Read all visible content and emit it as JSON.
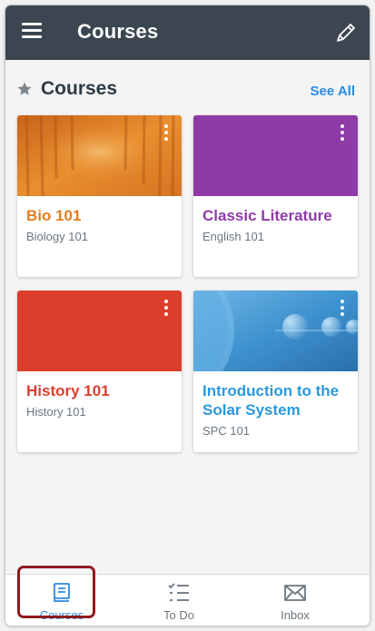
{
  "app_bar": {
    "title": "Courses",
    "menu_icon": "hamburger-menu-icon",
    "edit_icon": "pencil-icon"
  },
  "section": {
    "title": "Courses",
    "see_all": "See All",
    "star_icon": "star-icon"
  },
  "courses": [
    {
      "name": "Bio 101",
      "code": "Biology 101",
      "color": "#e27d1f"
    },
    {
      "name": "Classic Literature",
      "code": "English 101",
      "color": "#8e3ba8"
    },
    {
      "name": "History 101",
      "code": "History 101",
      "color": "#dc3e2e"
    },
    {
      "name": "Introduction to the Solar System",
      "code": "SPC 101",
      "color": "#2a99dc"
    }
  ],
  "bottom_nav": [
    {
      "label": "Courses",
      "icon": "courses-book-icon",
      "active": true,
      "color": "#2a8ce0"
    },
    {
      "label": "To Do",
      "icon": "todo-checklist-icon",
      "active": false,
      "color": "#6b7780"
    },
    {
      "label": "Inbox",
      "icon": "inbox-envelope-icon",
      "active": false,
      "color": "#6b7780"
    }
  ]
}
